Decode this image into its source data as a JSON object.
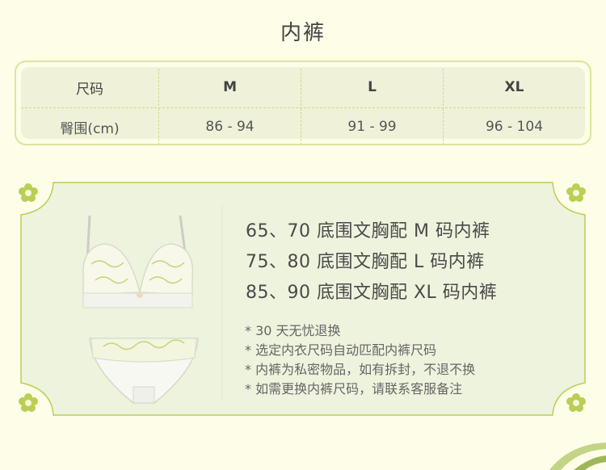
{
  "title": "内裤",
  "size_table": {
    "headers": [
      "尺码",
      "M",
      "L",
      "XL"
    ],
    "row_label": "臀围(cm)",
    "values": [
      "86 - 94",
      "91 - 99",
      "96 - 104"
    ]
  },
  "matches": [
    "65、70 底围文胸配 M 码内裤",
    "75、80 底围文胸配 L 码内裤",
    "85、90 底围文胸配 XL 码内裤"
  ],
  "notes": [
    "*  30 天无忧退换",
    "*  选定内衣尺码自动匹配内裤尺码",
    "*  内裤为私密物品，如有拆封，不退不换",
    "*  如需更换内裤尺码，请联系客服备注"
  ],
  "colors": {
    "background": "#fdfde8",
    "accent_green": "#b9cf55",
    "table_fill": "#eff2d9",
    "panel_fill": "#eef3dd"
  },
  "icons": [
    "flower-icon",
    "bra-set-image",
    "leaf-decoration"
  ]
}
